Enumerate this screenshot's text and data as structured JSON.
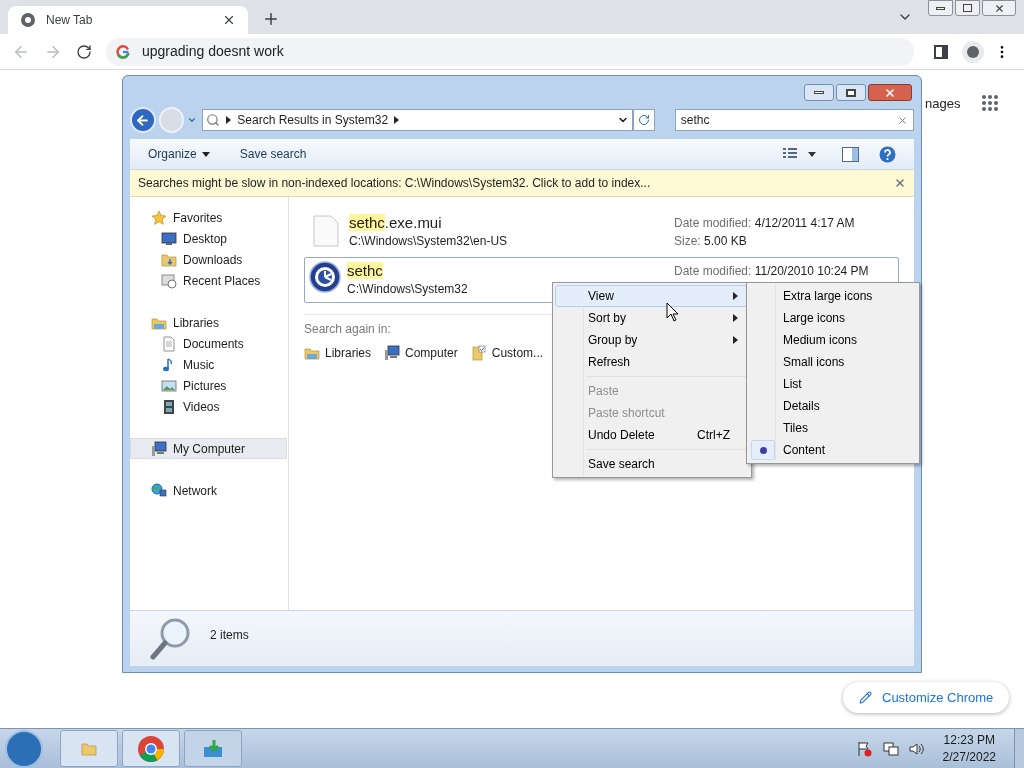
{
  "browser": {
    "tab_title": "New Tab",
    "address": "upgrading doesnt work"
  },
  "page": {
    "images_link": "nages",
    "customize_button": "Customize Chrome"
  },
  "explorer": {
    "breadcrumb": "Search Results in System32",
    "search_value": "sethc",
    "toolbar": [
      {
        "label": "Organize",
        "dropdown": true
      },
      {
        "label": "Save search",
        "dropdown": false
      }
    ],
    "info_bar": "Searches might be slow in non-indexed locations: C:\\Windows\\System32. Click to add to index...",
    "nav": [
      {
        "label": "Favorites",
        "selected": false,
        "children": [
          {
            "label": "Desktop",
            "selected": false
          },
          {
            "label": "Downloads",
            "selected": false
          },
          {
            "label": "Recent Places",
            "selected": false
          }
        ]
      },
      {
        "label": "Libraries",
        "selected": false,
        "children": [
          {
            "label": "Documents",
            "selected": false
          },
          {
            "label": "Music",
            "selected": false
          },
          {
            "label": "Pictures",
            "selected": false
          },
          {
            "label": "Videos",
            "selected": false
          }
        ]
      },
      {
        "label": "My Computer",
        "selected": true
      },
      {
        "label": "Network",
        "selected": false
      }
    ],
    "results": [
      {
        "match": "sethc",
        "rest": ".exe.mui",
        "path": "C:\\Windows\\System32\\en-US",
        "date_label": "Date modified:",
        "date": "4/12/2011 4:17 AM",
        "size_label": "Size:",
        "size": "5.00 KB",
        "selected": false
      },
      {
        "match": "sethc",
        "path": "C:\\Windows\\System32",
        "date_label": "Date modified:",
        "date": "11/20/2010 10:24 PM",
        "selected": true
      }
    ],
    "search_again": {
      "label": "Search again in:",
      "items": [
        "Libraries",
        "Computer",
        "Custom..."
      ]
    },
    "status": "2 items"
  },
  "context_menu": [
    {
      "kind": "item",
      "label": "View",
      "submenu": true,
      "selected": true,
      "disabled": false
    },
    {
      "kind": "item",
      "label": "Sort by",
      "submenu": true,
      "selected": false,
      "disabled": false
    },
    {
      "kind": "item",
      "label": "Group by",
      "submenu": true,
      "selected": false,
      "disabled": false
    },
    {
      "kind": "item",
      "label": "Refresh",
      "submenu": false,
      "selected": false,
      "disabled": false
    },
    {
      "kind": "separator"
    },
    {
      "kind": "item",
      "label": "Paste",
      "submenu": false,
      "selected": false,
      "disabled": true
    },
    {
      "kind": "item",
      "label": "Paste shortcut",
      "submenu": false,
      "selected": false,
      "disabled": true
    },
    {
      "kind": "item",
      "label": "Undo Delete",
      "shortcut": "Ctrl+Z",
      "submenu": false,
      "selected": false,
      "disabled": false
    },
    {
      "kind": "separator"
    },
    {
      "kind": "item",
      "label": "Save search",
      "submenu": false,
      "selected": false,
      "disabled": false
    }
  ],
  "view_submenu": [
    {
      "label": "Extra large icons",
      "selected": false
    },
    {
      "label": "Large icons",
      "selected": false
    },
    {
      "label": "Medium icons",
      "selected": false
    },
    {
      "label": "Small icons",
      "selected": false
    },
    {
      "label": "List",
      "selected": false
    },
    {
      "label": "Details",
      "selected": false
    },
    {
      "label": "Tiles",
      "selected": false
    },
    {
      "label": "Content",
      "selected": true
    }
  ],
  "taskbar": {
    "time": "12:23 PM",
    "date": "2/27/2022"
  }
}
